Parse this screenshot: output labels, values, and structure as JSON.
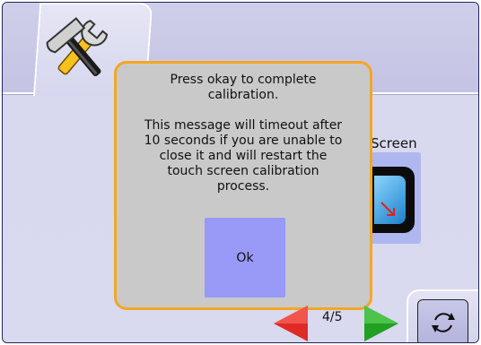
{
  "background": {
    "tab_icon": "tools-icon",
    "partial_label": "Screen",
    "screen_button_icon": "display-calibration-icon"
  },
  "dialog": {
    "line1": "Press okay to complete\ncalibration.",
    "line2": "This message will timeout after\n10 seconds if you are unable to\nclose it and will restart the\ntouch screen calibration\nprocess.",
    "ok_label": "Ok",
    "border_color": "#f5a623"
  },
  "navigation": {
    "page_indicator": "4/5",
    "prev_icon": "arrow-left-icon",
    "next_icon": "arrow-right-icon",
    "refresh_icon": "refresh-icon"
  }
}
